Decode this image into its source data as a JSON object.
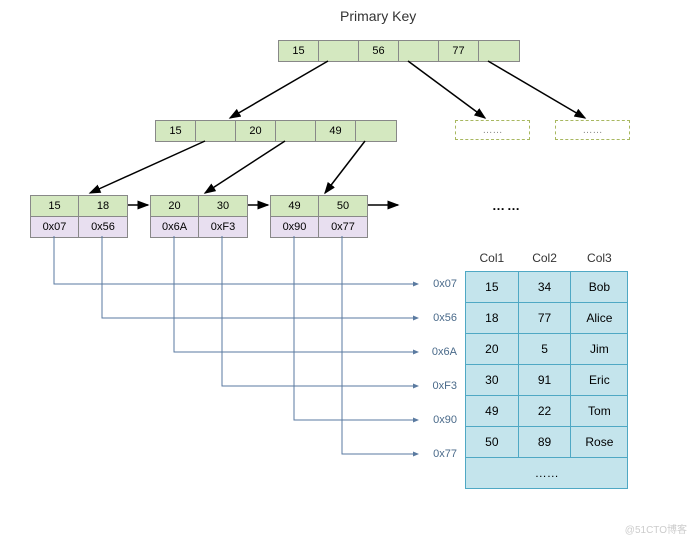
{
  "title": "Primary Key",
  "root": {
    "vals": [
      "15",
      "56",
      "77"
    ]
  },
  "internal": {
    "vals": [
      "15",
      "20",
      "49"
    ]
  },
  "dashed": [
    "……",
    "……"
  ],
  "leaves": [
    {
      "keys": [
        "15",
        "18"
      ],
      "ptrs": [
        "0x07",
        "0x56"
      ]
    },
    {
      "keys": [
        "20",
        "30"
      ],
      "ptrs": [
        "0x6A",
        "0xF3"
      ]
    },
    {
      "keys": [
        "49",
        "50"
      ],
      "ptrs": [
        "0x90",
        "0x77"
      ]
    }
  ],
  "leafEllipsis": "……",
  "pointer_links": [
    "0x07",
    "0x56",
    "0x6A",
    "0xF3",
    "0x90",
    "0x77"
  ],
  "table": {
    "headers": [
      "Col1",
      "Col2",
      "Col3"
    ],
    "rows": [
      [
        "15",
        "34",
        "Bob"
      ],
      [
        "18",
        "77",
        "Alice"
      ],
      [
        "20",
        "5",
        "Jim"
      ],
      [
        "30",
        "91",
        "Eric"
      ],
      [
        "49",
        "22",
        "Tom"
      ],
      [
        "50",
        "89",
        "Rose"
      ]
    ],
    "footer": "……"
  },
  "watermark": "@51CTO博客",
  "chart_data": {
    "type": "table",
    "structure": "b+tree-secondary-index",
    "root_level": {
      "keys": [
        15,
        56,
        77
      ]
    },
    "internal_level": {
      "keys": [
        15,
        20,
        49
      ]
    },
    "leaf_level": [
      {
        "key": 15,
        "pointer": "0x07"
      },
      {
        "key": 18,
        "pointer": "0x56"
      },
      {
        "key": 20,
        "pointer": "0x6A"
      },
      {
        "key": 30,
        "pointer": "0xF3"
      },
      {
        "key": 49,
        "pointer": "0x90"
      },
      {
        "key": 50,
        "pointer": "0x77"
      }
    ],
    "data_rows": [
      {
        "Col1": 15,
        "Col2": 34,
        "Col3": "Bob"
      },
      {
        "Col1": 18,
        "Col2": 77,
        "Col3": "Alice"
      },
      {
        "Col1": 20,
        "Col2": 5,
        "Col3": "Jim"
      },
      {
        "Col1": 30,
        "Col2": 91,
        "Col3": "Eric"
      },
      {
        "Col1": 49,
        "Col2": 22,
        "Col3": "Tom"
      },
      {
        "Col1": 50,
        "Col2": 89,
        "Col3": "Rose"
      }
    ]
  }
}
